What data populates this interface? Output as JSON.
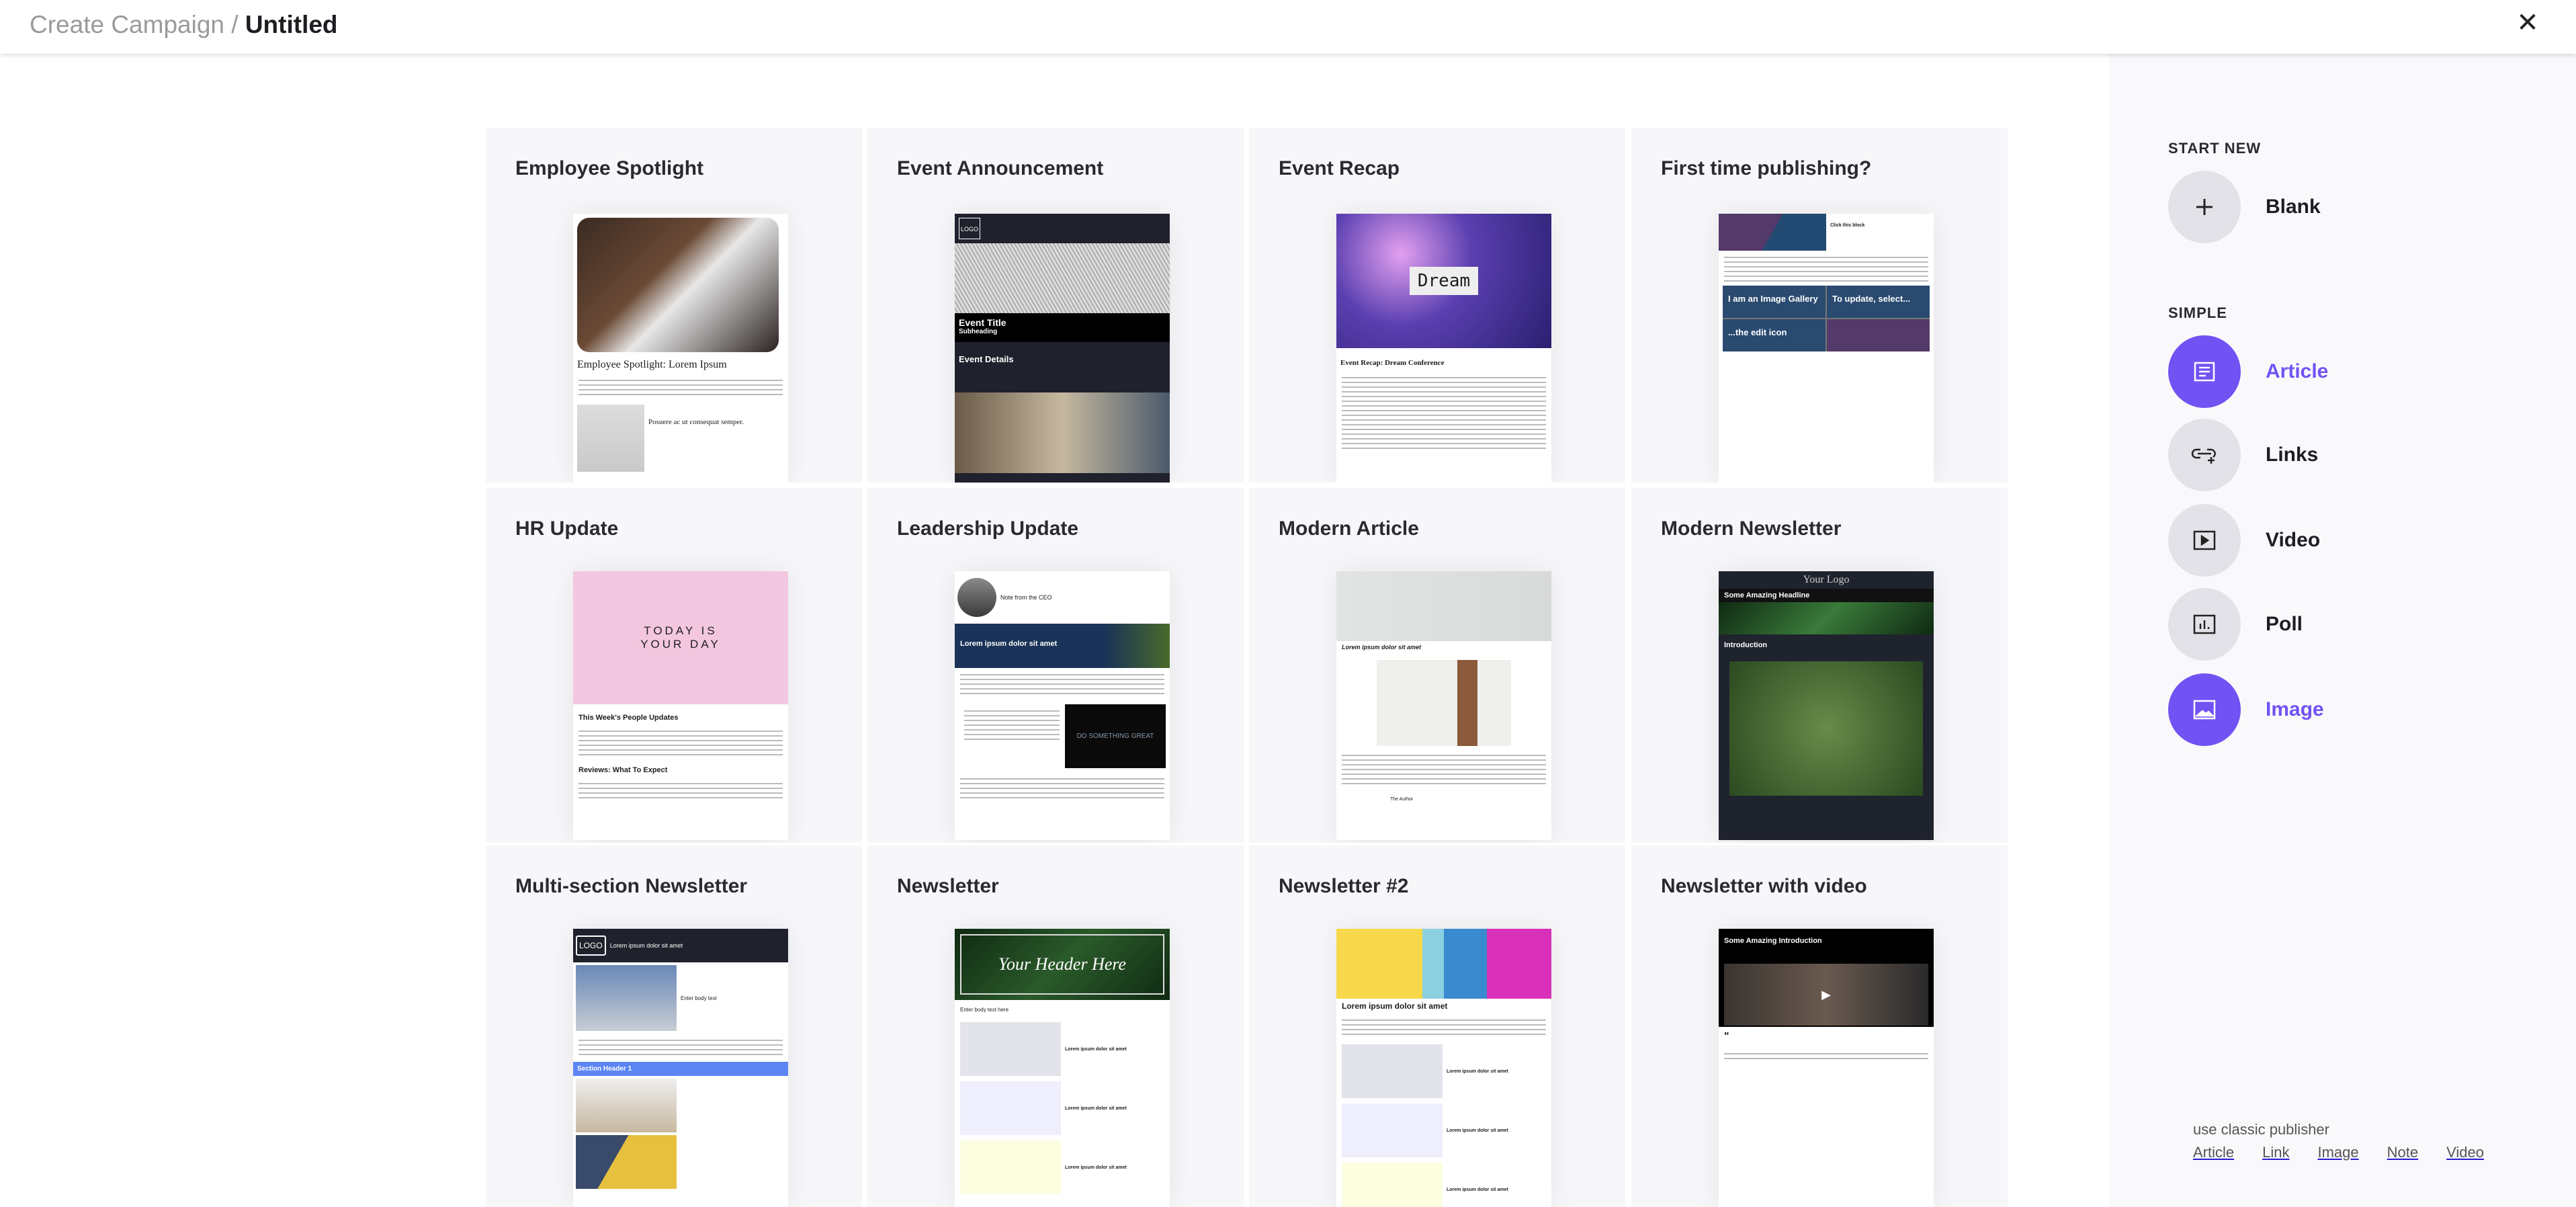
{
  "header": {
    "breadcrumb_parent": "Create Campaign /",
    "title": "Untitled",
    "close_icon": "close-icon"
  },
  "templates": [
    {
      "title": "Employee Spotlight",
      "heading": "Employee Spotlight: Lorem Ipsum",
      "sub": "Posuere ac ut consequat semper."
    },
    {
      "title": "Event Announcement",
      "logo": "LOGO",
      "heading": "Event Title",
      "sub": "Subheading",
      "details": "Event Details"
    },
    {
      "title": "Event Recap",
      "image_text": "Dream",
      "heading": "Event Recap: Dream Conference"
    },
    {
      "title": "First time publishing?",
      "heading": "Click this block",
      "gallery1": "I am an Image Gallery",
      "gallery2": "To update, select...",
      "gallery3": "...the edit icon"
    },
    {
      "title": "HR Update",
      "image_text": "TODAY IS YOUR DAY",
      "heading": "This Week's People Updates",
      "sub": "Reviews: What To Expect"
    },
    {
      "title": "Leadership Update",
      "note": "Note from the CEO",
      "heading": "Lorem ipsum dolor sit amet",
      "image_text": "DO SOMETHING GREAT"
    },
    {
      "title": "Modern Article",
      "heading": "Lorem ipsum dolor sit amet",
      "author": "The Author"
    },
    {
      "title": "Modern Newsletter",
      "logo": "Your Logo",
      "heading": "Some Amazing Headline",
      "sub": "Introduction"
    },
    {
      "title": "Multi-section Newsletter",
      "logo": "LOGO",
      "heading": "Lorem ipsum dolor sit amet",
      "body": "Enter body text",
      "sub": "Section Header 1"
    },
    {
      "title": "Newsletter",
      "heading": "Your Header Here",
      "body": "Enter body text here",
      "item": "Lorem ipsum dolor sit amet"
    },
    {
      "title": "Newsletter #2",
      "heading": "Lorem ipsum dolor sit amet",
      "item": "Lorem ipsum dolor sit amet"
    },
    {
      "title": "Newsletter with video",
      "heading": "Some Amazing Introduction"
    }
  ],
  "sidebar": {
    "start_new_label": "START NEW",
    "blank": "Blank",
    "simple_label": "SIMPLE",
    "options": [
      {
        "label": "Article",
        "icon": "article-icon",
        "active": true
      },
      {
        "label": "Links",
        "icon": "link-add-icon",
        "active": false
      },
      {
        "label": "Video",
        "icon": "video-icon",
        "active": false
      },
      {
        "label": "Poll",
        "icon": "poll-icon",
        "active": false
      },
      {
        "label": "Image",
        "icon": "image-icon",
        "active": true
      }
    ],
    "classic_label": "use classic publisher",
    "classic_links": [
      "Article",
      "Link",
      "Image",
      "Note",
      "Video"
    ]
  },
  "colors": {
    "accent": "#7152f3",
    "card_bg": "#f7f7fa",
    "circle_bg": "#e2e2e8"
  }
}
